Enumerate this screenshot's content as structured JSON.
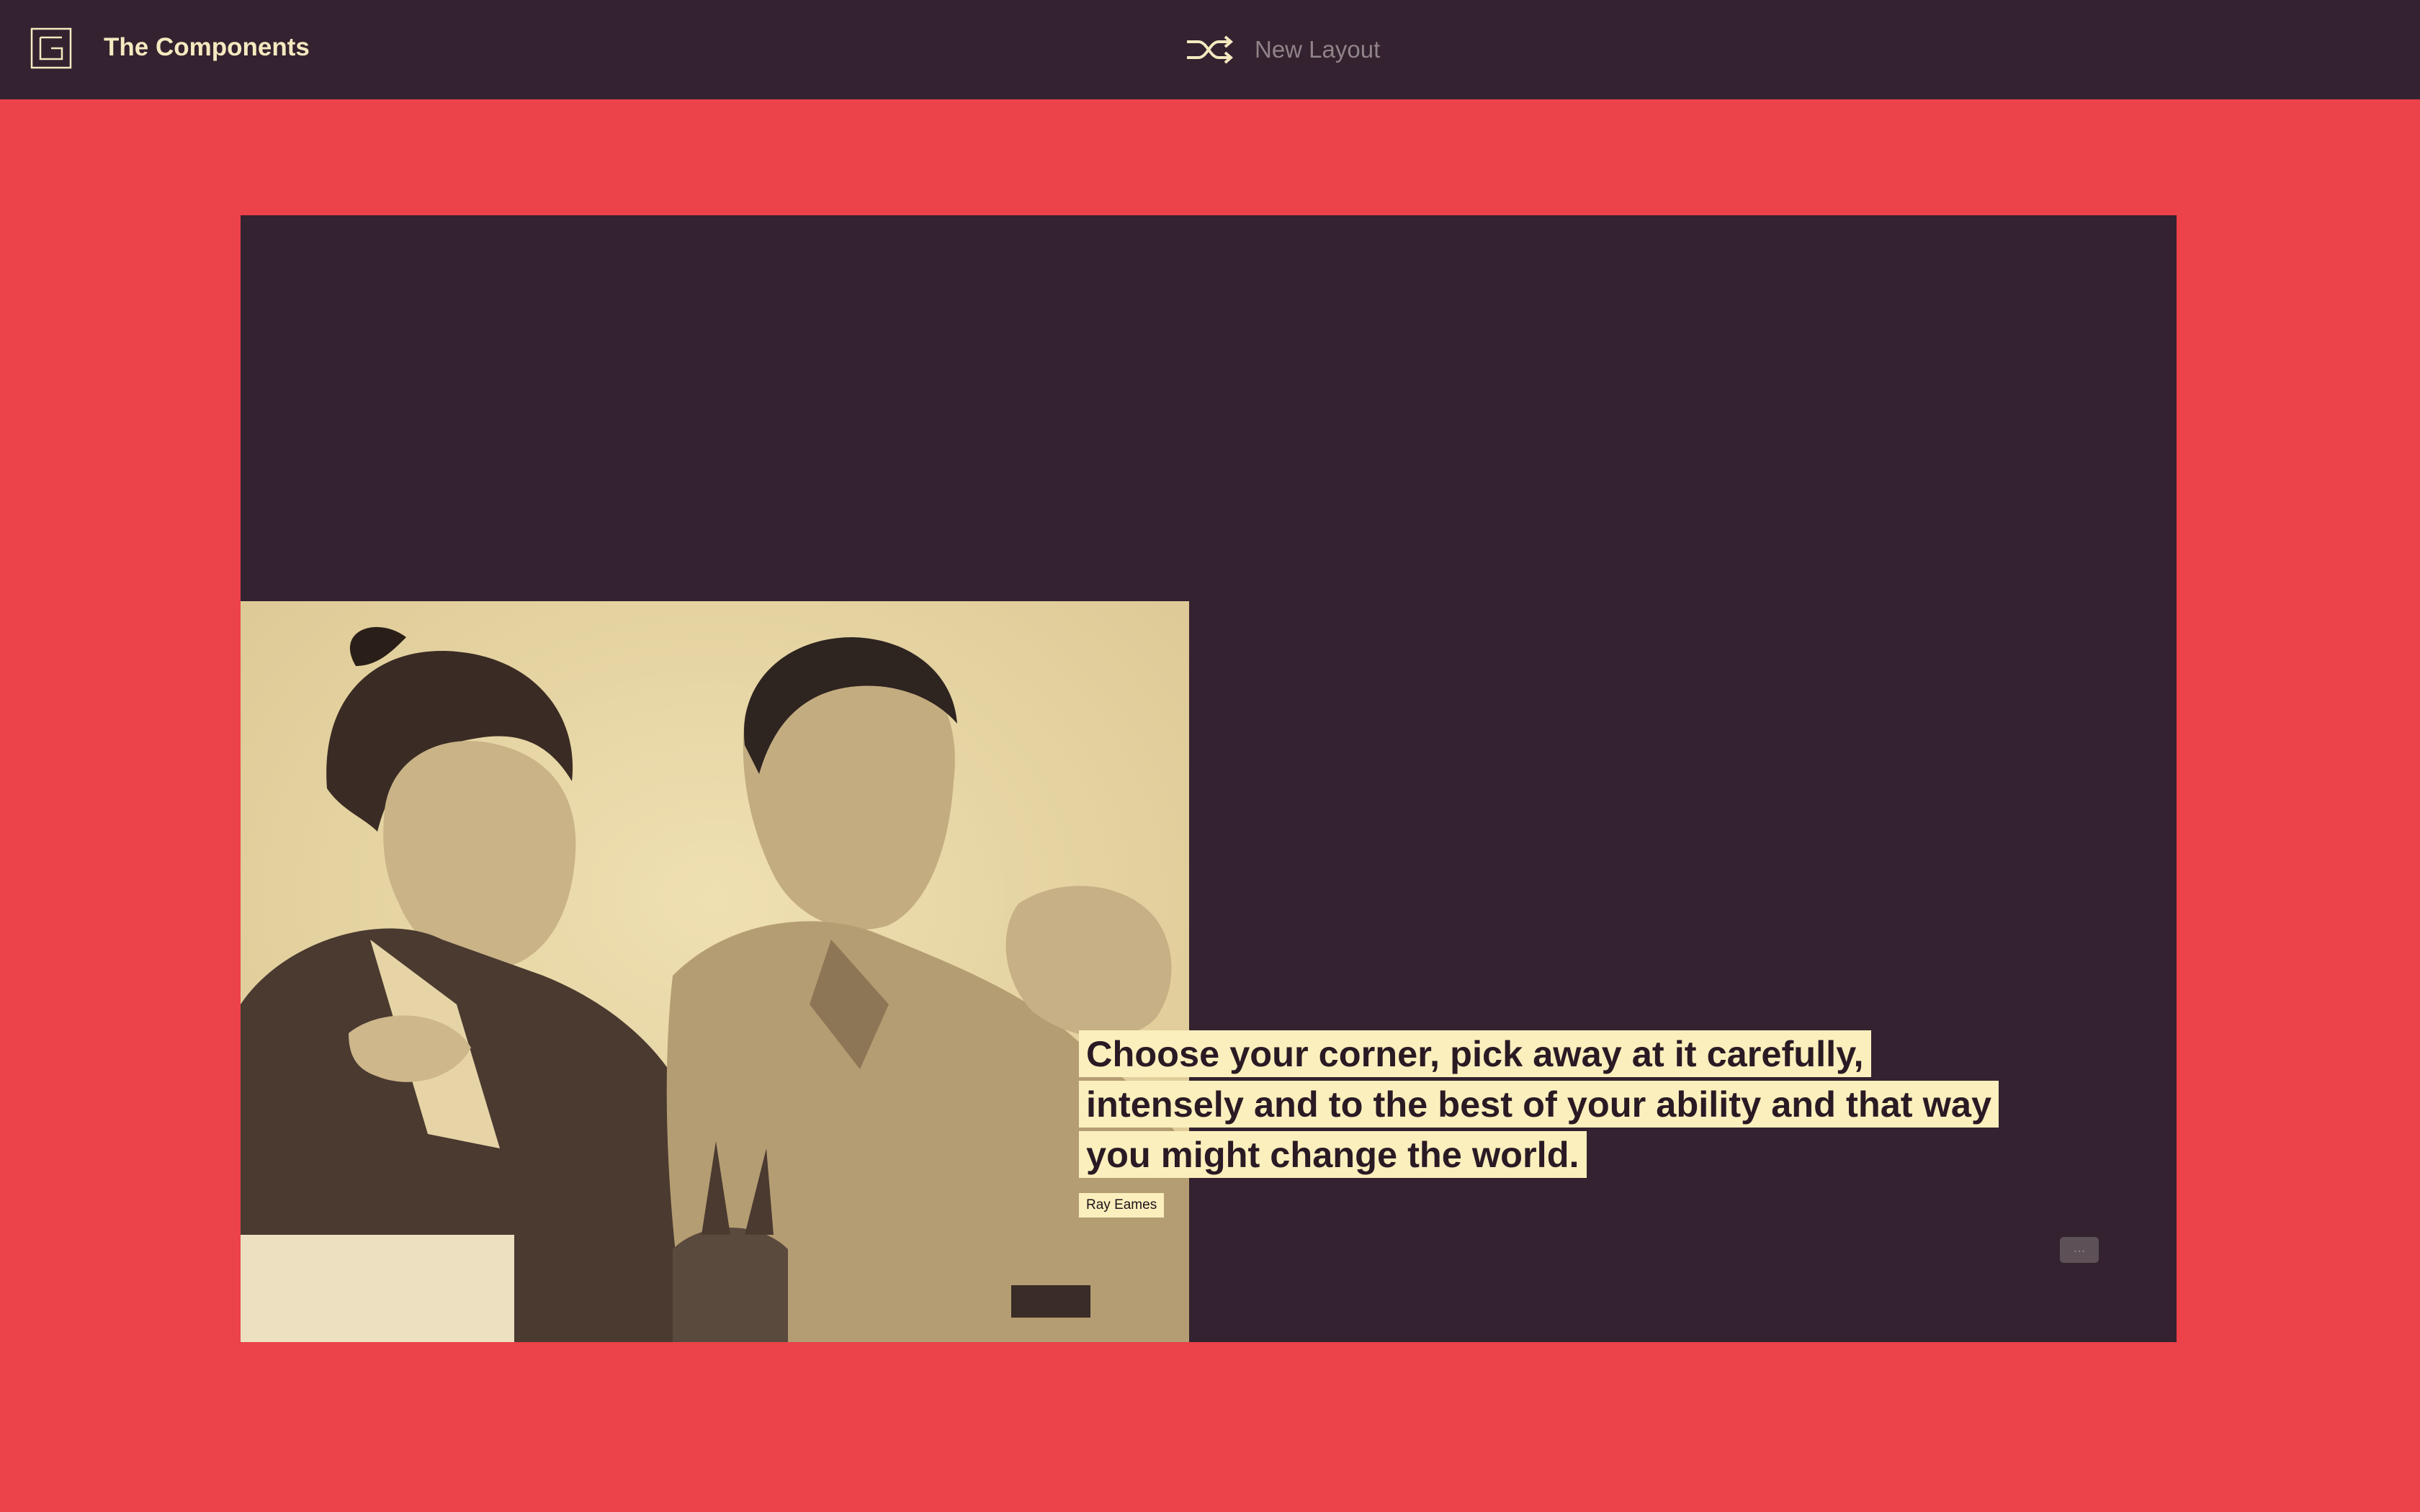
{
  "header": {
    "logo_icon": "grid-frame-logo-icon",
    "title": "The Components",
    "shuffle_icon": "shuffle-icon",
    "new_layout_label": "New Layout"
  },
  "main": {
    "photo": {
      "subject": "sepia photograph",
      "icon": "photo"
    },
    "quote": {
      "text": "Choose your corner, pick away at it carefully, intensely and to the best of your ability and that way you might change the world.",
      "author": "Ray Eames"
    },
    "more_button_label": "..."
  },
  "colors": {
    "background": "#ec4249",
    "panel": "#342230",
    "highlight": "#fbefbd",
    "header_text": "#f5e9c0",
    "muted_text": "#8f8388"
  }
}
